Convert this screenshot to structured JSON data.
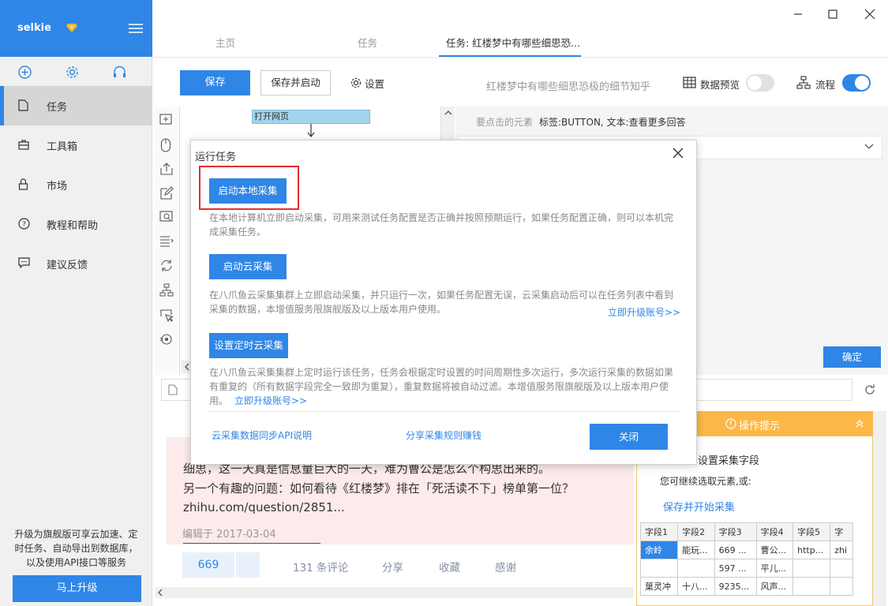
{
  "sidebar": {
    "brand": "selkie",
    "items": [
      {
        "label": "任务",
        "icon": "file-icon"
      },
      {
        "label": "工具箱",
        "icon": "toolbox-icon"
      },
      {
        "label": "市场",
        "icon": "lock-icon"
      },
      {
        "label": "教程和帮助",
        "icon": "help-icon"
      },
      {
        "label": "建议反馈",
        "icon": "feedback-icon"
      }
    ],
    "promo_lines": [
      "升级为旗舰版可享云加速、定",
      "时任务、自动导出到数据库，",
      "以及使用API接口等服务"
    ],
    "upgrade_label": "马上升级"
  },
  "tabs": [
    "主页",
    "任务",
    "任务: 红楼梦中有哪些细思恐..."
  ],
  "toolbar": {
    "save": "保存",
    "save_run": "保存并启动",
    "settings": "设置",
    "task_title": "红楼梦中有哪些细思恐极的细节知乎",
    "data_preview": "数据预览",
    "flow": "流程",
    "data_preview_on": false,
    "flow_on": true
  },
  "workflow": {
    "open_web": "打开网页"
  },
  "right_panel": {
    "element_label": "要点击的元素",
    "element_value": "标签:BUTTON, 文本:查看更多回答",
    "confirm": "确定"
  },
  "browser": {
    "lines": [
      "细思，这一天真是信息量巨大的一天，难为曹公是怎么个构思出来的。",
      "另一个有趣的问题：如何看待《红楼梦》排在「死活读不下」榜单第一位？",
      "zhihu.com/question/2851..."
    ],
    "edited": "编辑于 2017-03-04",
    "votes": "669",
    "comments": "131 条评论",
    "share": "分享",
    "favorite": "收藏",
    "thanks": "感谢"
  },
  "tip": {
    "header": "操作提示",
    "title": "设置采集字段",
    "subtitle": "您可继续选取元素,或:",
    "link": "保存并开始采集",
    "table": [
      [
        "字段1",
        "字段2",
        "字段3",
        "字段4",
        "字段5",
        "字"
      ],
      [
        "余岭",
        "能玩...",
        "669 ...",
        "曹公...",
        "http...",
        "zhi"
      ],
      [
        "",
        "",
        "597 ...",
        "平儿...",
        "",
        ""
      ],
      [
        "葉灵冲",
        "十八...",
        "9235...",
        "风声...",
        "",
        ""
      ]
    ]
  },
  "dialog": {
    "title": "运行任务",
    "local_btn": "启动本地采集",
    "local_desc": "在本地计算机立即启动采集，可用来测试任务配置是否正确并按照预期运行，如果任务配置正确，则可以本机完成采集任务。",
    "cloud_btn": "启动云采集",
    "cloud_desc": "在八爪鱼云采集集群上立即启动采集，并只运行一次，如果任务配置无误，云采集启动后可以在任务列表中看到采集的数据，本增值服务限旗舰版及以上版本用户使用。",
    "cloud_link": "立即升级账号>>",
    "sched_btn": "设置定时云采集",
    "sched_desc": "在八爪鱼云采集集群上定时运行该任务，任务会根据定时设置的时间周期性多次运行，多次运行采集的数据如果有重复的（所有数据字段完全一致即为重复），重复数据将被自动过滤。本增值服务限旗舰版及以上版本用户使用。",
    "sched_link": "立即升级账号>>",
    "api_link": "云采集数据同步API说明",
    "share_link": "分享采集规则赚钱",
    "close": "关闭"
  },
  "colors": {
    "accent": "#2f86e6",
    "tip": "#fbb847",
    "highlight": "#e03030"
  }
}
